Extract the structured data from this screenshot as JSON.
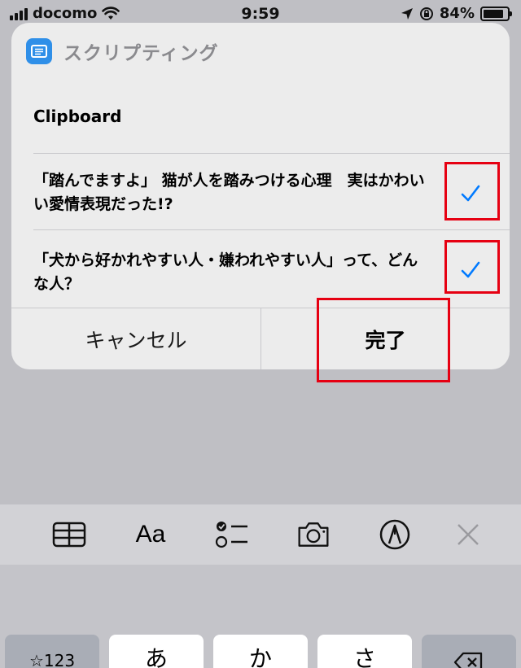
{
  "status_bar": {
    "carrier": "docomo",
    "time": "9:59",
    "battery": "84%",
    "battery_level": 0.84
  },
  "dialog": {
    "app_name": "スクリプティング",
    "section_title": "Clipboard",
    "items": [
      {
        "text": "「踏んでますよ」 猫が人を踏みつける心理　実はかわいい愛情表現だった!?",
        "checked": true
      },
      {
        "text": "「犬から好かれやすい人・嫌われやすい人」って、どんな人？",
        "checked": true
      }
    ],
    "cancel_label": "キャンセル",
    "done_label": "完了"
  },
  "toolbar": {
    "icons": [
      "table-icon",
      "text-format-icon",
      "checklist-icon",
      "camera-icon",
      "markup-pen-icon",
      "close-icon"
    ],
    "format_label": "Aa"
  },
  "keyboard": {
    "keys": [
      "☆123",
      "あ",
      "か",
      "さ"
    ]
  },
  "colors": {
    "accent": "#007aff",
    "highlight": "#e60012",
    "app_icon": "#2f8fe8"
  }
}
